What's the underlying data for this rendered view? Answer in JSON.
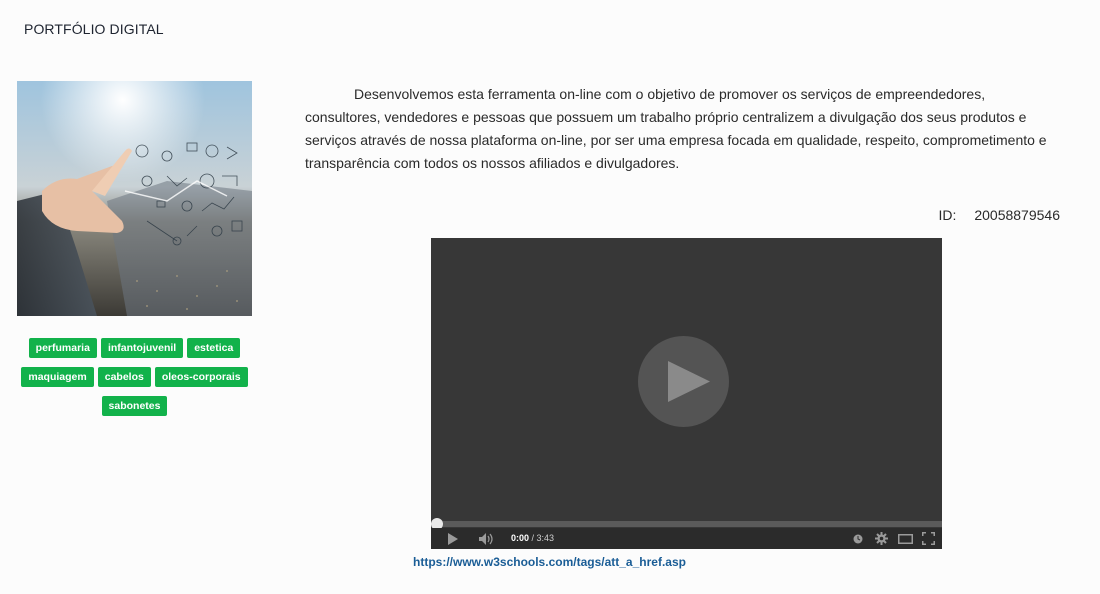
{
  "page": {
    "title": "PORTFÓLIO DIGITAL"
  },
  "description": "Desenvolvemos esta ferramenta on-line com o objetivo de promover os serviços de empreendedores, consultores, vendedores e pessoas que possuem um trabalho próprio centralizem a divulgação dos seus produtos e serviços através de nossa plataforma on-line, por ser uma empresa focada em qualidade, respeito, comprometimento e transparência com todos os nossos afiliados e divulgadores.",
  "id": {
    "label": "ID:",
    "value": "20058879546"
  },
  "tags": [
    {
      "label": "perfumaria"
    },
    {
      "label": "infantojuvenil"
    },
    {
      "label": "estetica"
    },
    {
      "label": "maquiagem"
    },
    {
      "label": "cabelos"
    },
    {
      "label": "oleos-corporais"
    },
    {
      "label": "sabonetes"
    }
  ],
  "video": {
    "current_time": "0:00",
    "separator": " / ",
    "duration": "3:43",
    "progress": 0
  },
  "link": {
    "text": "https://www.w3schools.com/tags/att_a_href.asp"
  },
  "colors": {
    "tag": "#12b24b",
    "link": "#1a5d96",
    "player_bg": "#373737"
  }
}
